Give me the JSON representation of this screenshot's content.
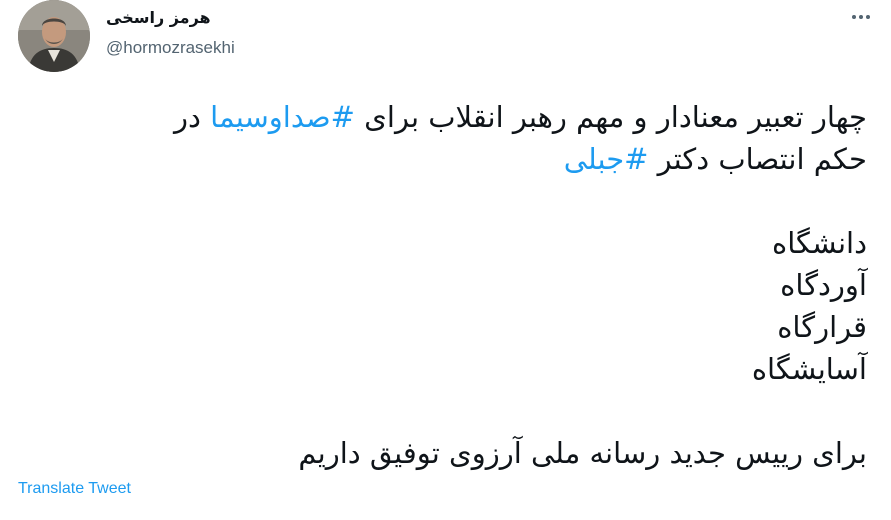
{
  "author": {
    "display_name": "هرمز راسخی",
    "handle": "@hormozrasekhi",
    "avatar": "avatar-photo"
  },
  "more_icon": "more-horizontal-icon",
  "tweet": {
    "line1_text": "چهار تعبیر معنادار و مهم رهبر انقلاب برای ",
    "line1_tag": "#صداوسیما",
    "line1_end": " در",
    "line2_text": "حکم انتصاب دکتر ",
    "line2_tag": "#جبلی",
    "list": [
      "دانشگاه",
      "آوردگاه",
      "قرارگاه",
      "آسایشگاه"
    ],
    "closing": "برای رییس جدید رسانه ملی آرزوی توفیق داریم"
  },
  "translate_label": "Translate Tweet",
  "colors": {
    "link": "#1d9bf0",
    "text": "#0f1419",
    "muted": "#536471"
  }
}
